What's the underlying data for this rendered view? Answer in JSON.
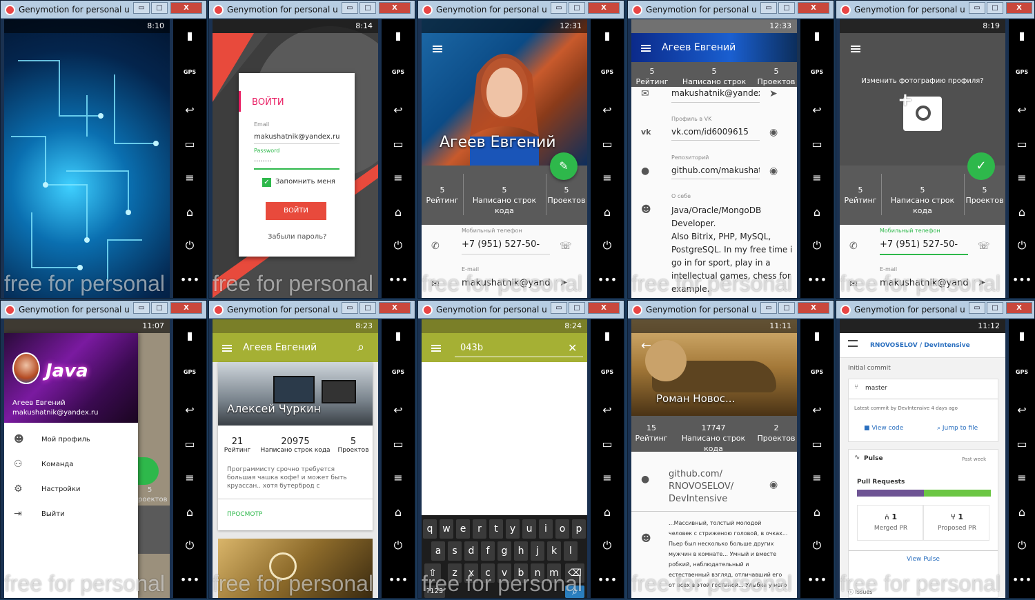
{
  "window_title": "Genymotion for personal use...",
  "win_buttons": {
    "min": "▭",
    "max": "□",
    "close": "X"
  },
  "side": {
    "battery": "▮",
    "gps": "GPS",
    "back": "↩",
    "recent": "▭",
    "menu": "≡",
    "home": "⌂",
    "power": "⏻",
    "more": "•••"
  },
  "watermark": "free for personal",
  "colors": {
    "accent_pink": "#e91e63",
    "olive": "#a5b034",
    "green": "#2eb84b",
    "gray": "#5a5a5a"
  },
  "s1": {
    "time": "8:10"
  },
  "s2": {
    "time": "8:14",
    "title": "ВОЙТИ",
    "email_label": "Email",
    "email": "makushatnik@yandex.ru",
    "pw_label": "Password",
    "pw": "........",
    "remember": "Запомнить меня",
    "button": "ВОЙТИ",
    "forgot": "Забыли пароль?"
  },
  "s3": {
    "time": "12:31",
    "name": "Агеев Евгений",
    "stats": [
      {
        "v": "5",
        "l": "Рейтинг"
      },
      {
        "v": "5",
        "l": "Написано строк кода"
      },
      {
        "v": "5",
        "l": "Проектов"
      }
    ],
    "phone_label": "Мобильный телефон",
    "phone": "+7 (951) 527-50-",
    "email_label": "E-mail",
    "email": "makushatnik@yandex.r"
  },
  "s4": {
    "time": "12:33",
    "name": "Агеев Евгений",
    "stats": [
      {
        "v": "5",
        "l": "Рейтинг"
      },
      {
        "v": "5",
        "l": "Написано строк кода"
      },
      {
        "v": "5",
        "l": "Проектов"
      }
    ],
    "email": "makushatnik@yandex.r",
    "vk_label": "Профиль в VK",
    "vk": "vk.com/id6009615",
    "repo_label": "Репозиторий",
    "repo": "github.com/makushatn",
    "about_label": "О себе",
    "about": [
      "Java/Oracle/MongoDB",
      "Developer.",
      "Also Bitrix, PHP, MySQL,",
      "PostgreSQL. In my free time i",
      "go in for sport, play in a",
      "intellectual games, chess for",
      "example."
    ]
  },
  "s5": {
    "time": "8:19",
    "question": "Изменить фотографию профиля?",
    "stats": [
      {
        "v": "5",
        "l": "Рейтинг"
      },
      {
        "v": "5",
        "l": "Написано строк кода"
      },
      {
        "v": "5",
        "l": "Проектов"
      }
    ],
    "phone_label": "Мобильный телефон",
    "phone": "+7 (951) 527-50-",
    "email_label": "E-mail",
    "email": "makushatnik@yandex.r"
  },
  "s6": {
    "time": "11:07",
    "java": "Java",
    "name": "Агеев Евгений",
    "email": "makushatnik@yandex.ru",
    "menu": [
      "Мой профиль",
      "Команда",
      "Настройки",
      "Выйти"
    ],
    "peek_num": "5",
    "peek_label": "роектов"
  },
  "s7": {
    "time": "8:23",
    "title": "Агеев Евгений",
    "card_name": "Алексей Чуркин",
    "stats": [
      {
        "v": "21",
        "l": "Рейтинг"
      },
      {
        "v": "20975",
        "l": "Написано строк кода"
      },
      {
        "v": "5",
        "l": "Проектов"
      }
    ],
    "bio": "Программисту срочно требуется большая чашка кофе! и может быть круассан.. хотя бутерброд с",
    "view": "ПРОСМОТР"
  },
  "s8": {
    "time": "8:24",
    "query": "043b",
    "rows": [
      [
        "q",
        "w",
        "e",
        "r",
        "t",
        "y",
        "u",
        "i",
        "o",
        "p"
      ],
      [
        "a",
        "s",
        "d",
        "f",
        "g",
        "h",
        "j",
        "k",
        "l"
      ],
      [
        "z",
        "x",
        "c",
        "v",
        "b",
        "n",
        "m"
      ]
    ],
    "sym": "?123"
  },
  "s9": {
    "time": "11:11",
    "name": "Роман Новос...",
    "stats": [
      {
        "v": "15",
        "l": "Рейтинг"
      },
      {
        "v": "17747",
        "l": "Написано строк кода"
      },
      {
        "v": "2",
        "l": "Проектов"
      }
    ],
    "repo": [
      "github.com/",
      "RNOVOSELOV/",
      "DevIntensive"
    ],
    "about": [
      "...Массивный, толстый молодой",
      "человек с стриженою головой, в очках...",
      "Пьер был несколько больше других",
      "мужчин в комнате... Умный и вместе",
      "робкий, наблюдательный и",
      "естественный взгляд, отличавший его",
      "от всех в этой гостиной... Улыбка у него"
    ]
  },
  "s10": {
    "time": "11:12",
    "repo": "RNOVOSELOV / DevIntensive",
    "commit": "Initial commit",
    "branch": "master",
    "latest": "Latest commit by DevIntensive 4 days ago",
    "view_code": "View code",
    "jump": "Jump to file",
    "pulse": "Pulse",
    "past_week": "Past week",
    "pull_requests": "Pull Requests",
    "merged_n": "1",
    "merged": "Merged PR",
    "proposed_n": "1",
    "proposed": "Proposed PR",
    "view_pulse": "View Pulse",
    "issues": "Issues"
  }
}
